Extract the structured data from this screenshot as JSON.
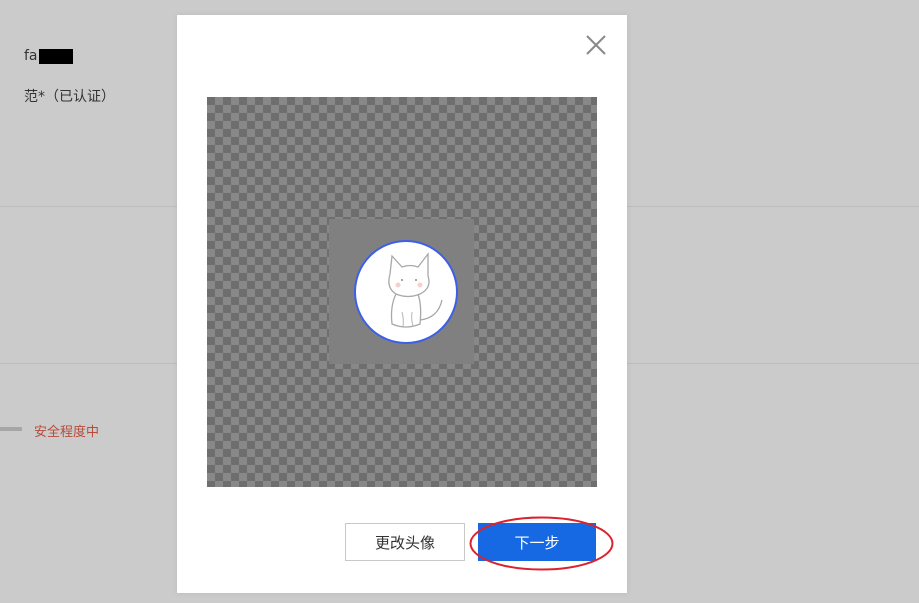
{
  "background": {
    "username_visible": "fa",
    "realname": "范*（已认证）",
    "security_level": "安全程度中"
  },
  "modal": {
    "close_icon": "close-icon",
    "avatar_icon": "cat-sketch-avatar",
    "buttons": {
      "change_avatar": "更改头像",
      "next_step": "下一步"
    }
  },
  "colors": {
    "primary": "#1669e3",
    "avatar_ring": "#3c5fe8",
    "annotation": "#d9232e",
    "security_text": "#b64b3a"
  }
}
